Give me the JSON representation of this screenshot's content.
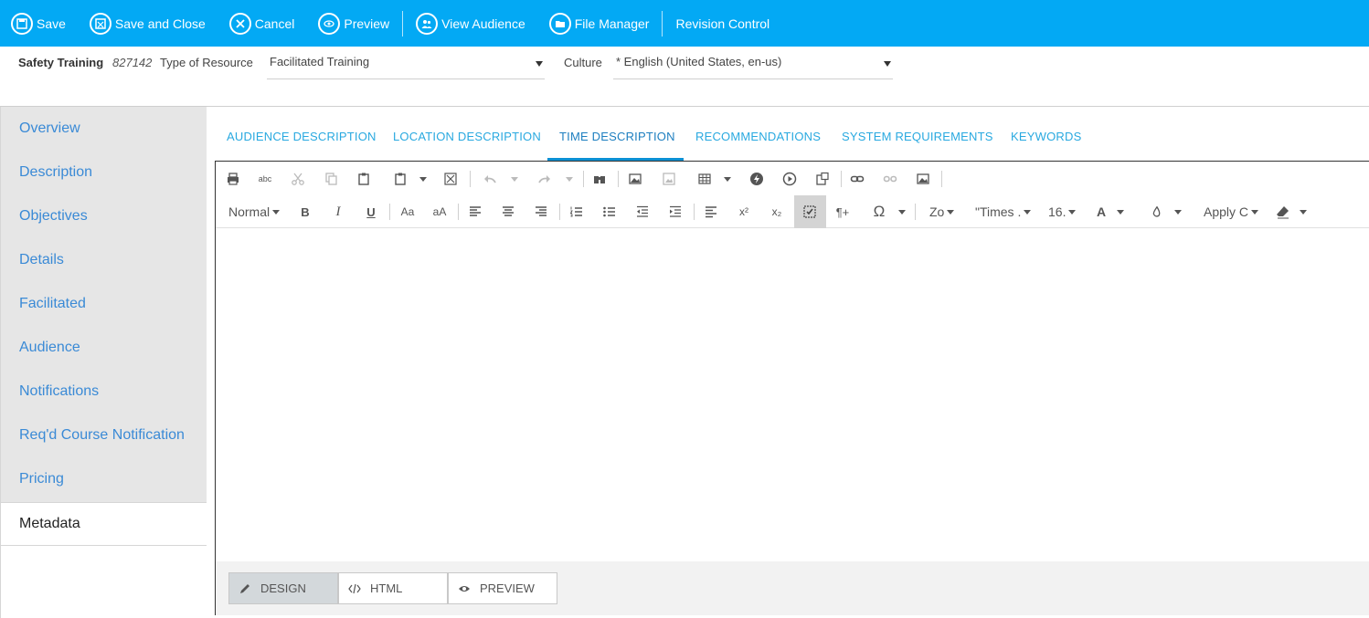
{
  "toolbar": {
    "save": "Save",
    "save_close": "Save and Close",
    "cancel": "Cancel",
    "preview": "Preview",
    "view_audience": "View Audience",
    "file_manager": "File Manager",
    "revision_control": "Revision Control"
  },
  "header": {
    "title": "Safety Training",
    "code": "827142",
    "type_label": "Type of Resource",
    "type_value": "Facilitated Training",
    "culture_label": "Culture",
    "culture_value": "* English (United States, en-us)"
  },
  "sidebar": {
    "items": [
      "Overview",
      "Description",
      "Objectives",
      "Details",
      "Facilitated",
      "Audience",
      "Notifications",
      "Req'd Course Notification",
      "Pricing"
    ],
    "active": "Metadata"
  },
  "tabs": [
    "AUDIENCE DESCRIPTION",
    "LOCATION DESCRIPTION",
    "TIME DESCRIPTION",
    "RECOMMENDATIONS",
    "SYSTEM REQUIREMENTS",
    "KEYWORDS"
  ],
  "editor": {
    "format": "Normal",
    "zoom": "Zo",
    "font": "\"Times .",
    "size": "16.",
    "apply_css": "Apply C",
    "glyph_bold": "B",
    "glyph_italic": "I",
    "glyph_underline": "U",
    "glyph_case1": "Aa",
    "glyph_case2": "aA",
    "glyph_sup": "x²",
    "glyph_sub": "x₂",
    "glyph_para": "¶+",
    "glyph_omega": "Ω",
    "glyph_fontcolor": "A",
    "glyph_spell": "abc",
    "modes": {
      "design": "DESIGN",
      "html": "HTML",
      "preview": "PREVIEW"
    }
  },
  "colors": {
    "topbar": "#03a9f4",
    "tab_text": "#29a9e0",
    "tab_underline": "#0c90d4",
    "sidebar_link": "#3a8ad6"
  }
}
